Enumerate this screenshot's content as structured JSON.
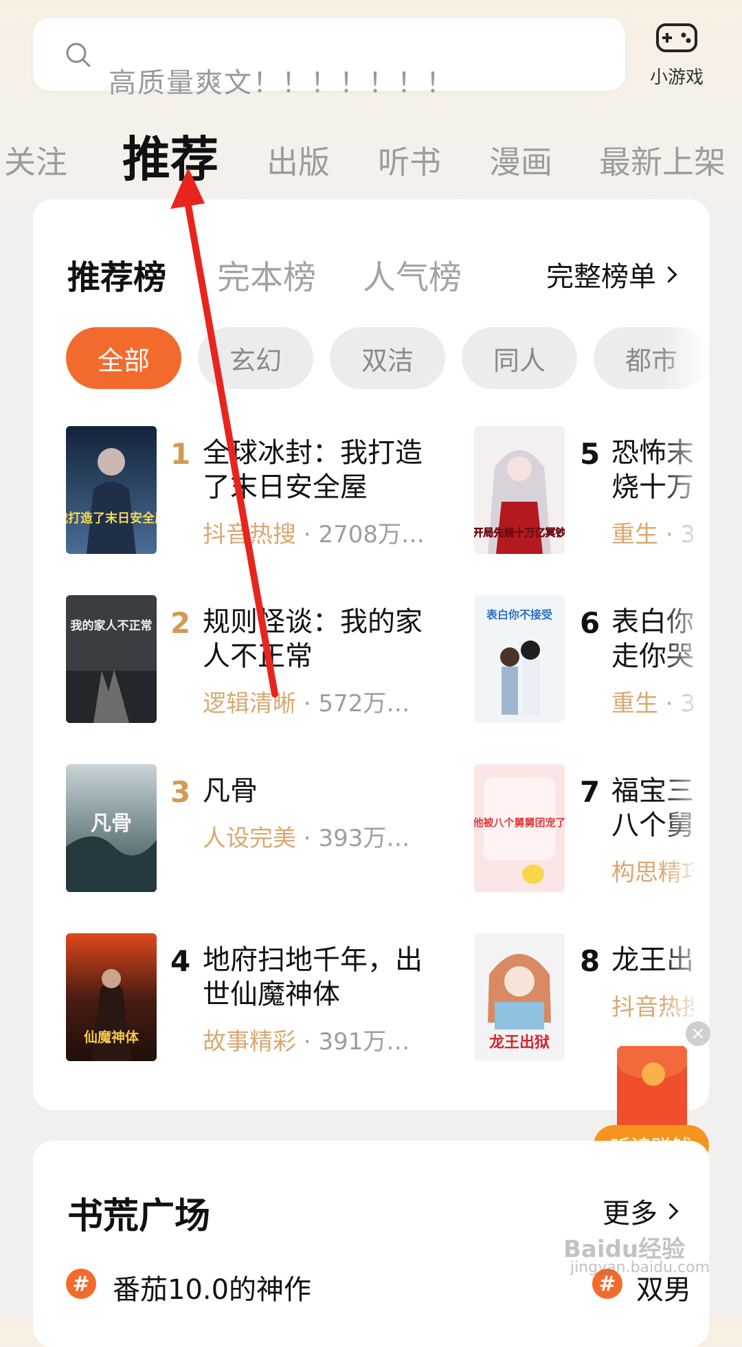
{
  "search": {
    "placeholder": "高质量爽文！！！！！！！"
  },
  "games": {
    "label": "小游戏",
    "icon": "gamepad-icon"
  },
  "top_tabs": [
    "关注",
    "推荐",
    "出版",
    "听书",
    "漫画",
    "最新上架"
  ],
  "top_tabs_active": "推荐",
  "ranking": {
    "tabs": [
      "推荐榜",
      "完本榜",
      "人气榜"
    ],
    "full_list": "完整榜单",
    "filters": [
      "全部",
      "玄幻",
      "双洁",
      "同人",
      "都市"
    ],
    "books_left": [
      {
        "rank": "1",
        "title": "全球冰封：我打造了末日安全屋",
        "tag": "抖音热搜",
        "count": "2708万…"
      },
      {
        "rank": "2",
        "title": "规则怪谈：我的家人不正常",
        "tag": "逻辑清晰",
        "count": "572万…"
      },
      {
        "rank": "3",
        "title": "凡骨",
        "tag": "人设完美",
        "count": "393万…"
      },
      {
        "rank": "4",
        "title": "地府扫地千年，出世仙魔神体",
        "tag": "故事精彩",
        "count": "391万…"
      }
    ],
    "books_right": [
      {
        "rank": "5",
        "title": "恐怖末\n烧十万",
        "tag": "重生",
        "suffix": "3"
      },
      {
        "rank": "6",
        "title": "表白你\n走你哭",
        "tag": "重生",
        "suffix": "3"
      },
      {
        "rank": "7",
        "title": "福宝三\n八个舅",
        "tag": "构思精巧",
        "suffix": ""
      },
      {
        "rank": "8",
        "title": "龙王出",
        "tag": "抖音热搜",
        "suffix": ""
      }
    ]
  },
  "cover_text": {
    "c1": "我打造了末日安全屋",
    "c2": "我的家人不正常",
    "c3": "凡骨",
    "c4": "仙魔神体",
    "c5": "开局先烧十万亿冥钞",
    "c6": "表白你不接受",
    "c7": "他被八个舅舅团宠了",
    "c8": "龙王出狱"
  },
  "square": {
    "title": "书荒广场",
    "more": "更多",
    "topic1": "番茄10.0的神作",
    "topic2": "双男"
  },
  "float": {
    "earn": "听读赚钱",
    "close": "×"
  },
  "watermark": {
    "line1": "Baidu经验",
    "line2": "jingyan.baidu.com"
  },
  "colors": {
    "accent": "#f36b2c",
    "tag": "#d8a870",
    "rank_gold": "#d39a54",
    "annotation": "#e8251c"
  }
}
